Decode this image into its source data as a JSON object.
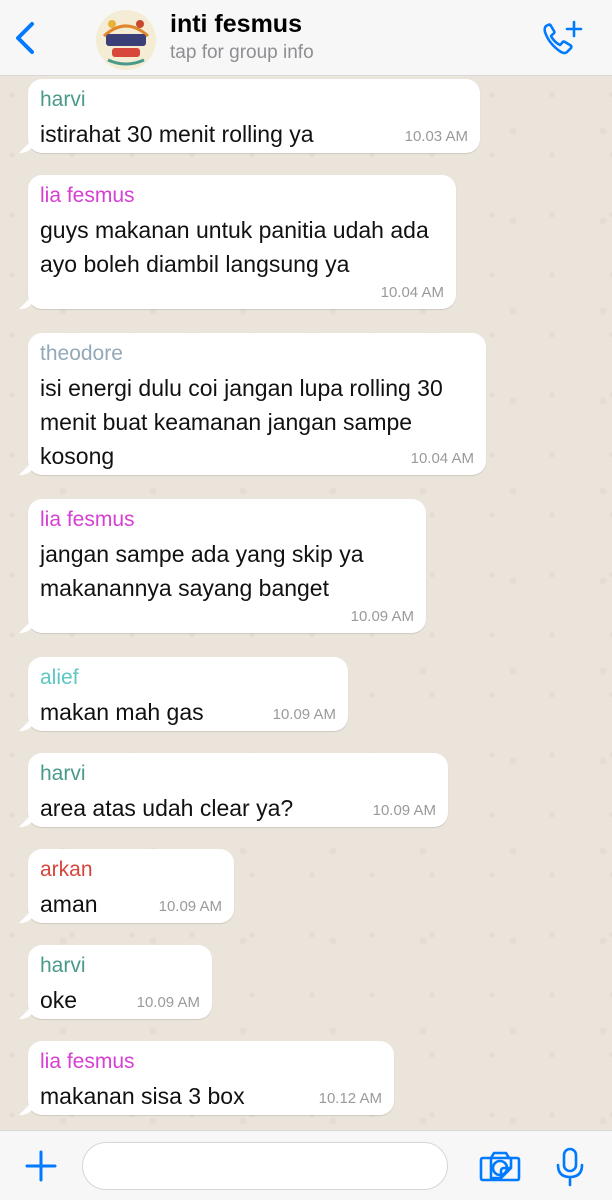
{
  "header": {
    "title": "inti fesmus",
    "subtitle": "tap for group info",
    "avatar_text": "MUSIC FESTIVAL",
    "icons": {
      "back": "chevron-left-icon",
      "call": "phone-plus-icon"
    },
    "accent": "#007aff"
  },
  "messages": [
    {
      "sender": "harvi",
      "color": "#4a9a8a",
      "text": "istirahat 30 menit rolling ya",
      "time": "10.03 AM"
    },
    {
      "sender": "lia fesmus",
      "color": "#d63fd2",
      "text": "guys makanan untuk panitia udah ada ayo boleh diambil langsung ya",
      "time": "10.04 AM"
    },
    {
      "sender": "theodore",
      "color": "#93a9b9",
      "text": "isi energi dulu coi jangan lupa rolling 30 menit buat keamanan jangan sampe kosong",
      "time": "10.04 AM"
    },
    {
      "sender": "lia fesmus",
      "color": "#d63fd2",
      "text": "jangan sampe ada yang skip ya makanannya sayang banget",
      "time": "10.09 AM"
    },
    {
      "sender": "alief",
      "color": "#5cc7c1",
      "text": "makan mah gas",
      "time": "10.09 AM"
    },
    {
      "sender": "harvi",
      "color": "#4a9a8a",
      "text": "area atas udah clear ya?",
      "time": "10.09 AM"
    },
    {
      "sender": "arkan",
      "color": "#d4463c",
      "text": "aman",
      "time": "10.09 AM"
    },
    {
      "sender": "harvi",
      "color": "#4a9a8a",
      "text": "oke",
      "time": "10.09 AM"
    },
    {
      "sender": "lia fesmus",
      "color": "#d63fd2",
      "text": "makanan sisa 3 box",
      "time": "10.12 AM"
    }
  ],
  "composer": {
    "placeholder": "",
    "icons": {
      "plus": "plus-icon",
      "sticker": "sticker-icon",
      "camera": "camera-icon",
      "mic": "microphone-icon"
    }
  }
}
